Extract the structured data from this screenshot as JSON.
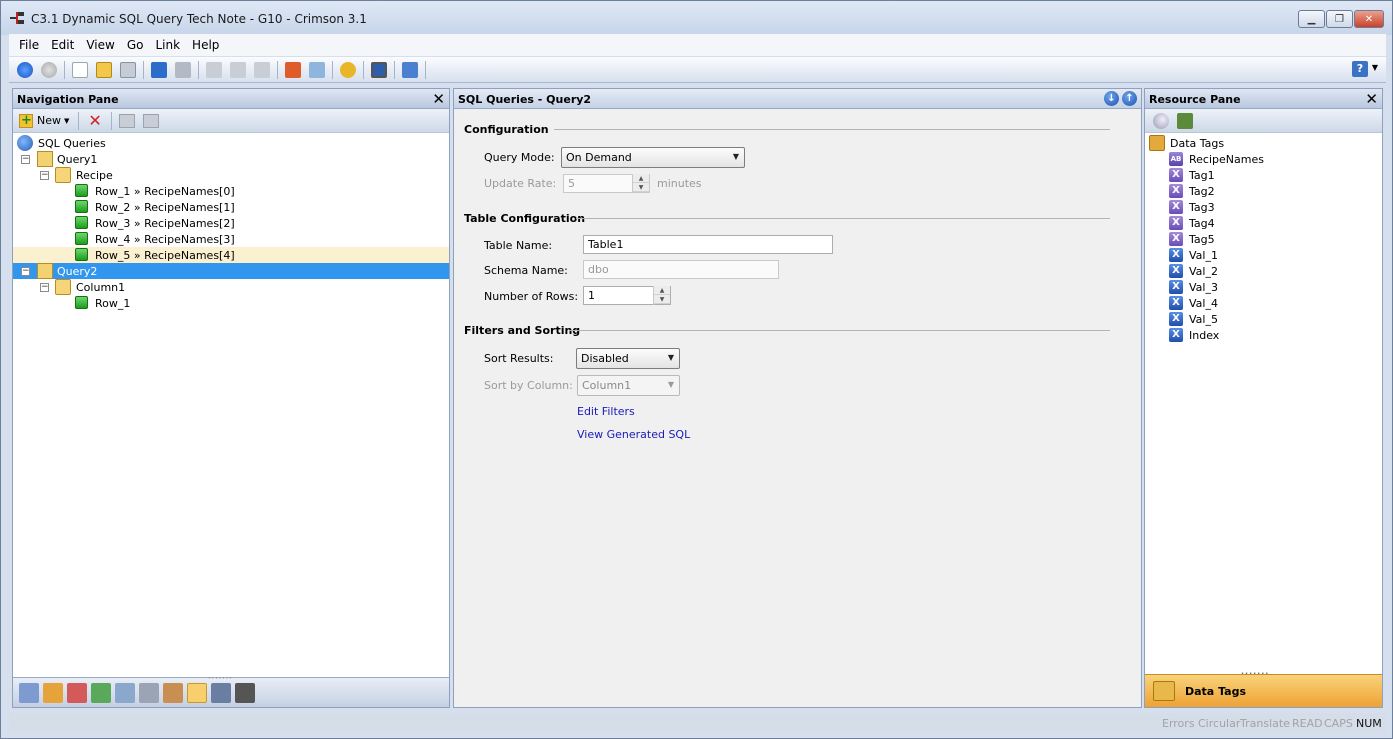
{
  "window": {
    "title": "C3.1 Dynamic SQL Query Tech Note - G10 - Crimson 3.1",
    "minimize": "▁",
    "maximize": "❐",
    "close": "✕"
  },
  "menu": [
    "File",
    "Edit",
    "View",
    "Go",
    "Link",
    "Help"
  ],
  "toolbar": {
    "help_label": "?"
  },
  "nav_pane": {
    "title": "Navigation Pane",
    "new_label": "New",
    "tree": {
      "root": "SQL Queries",
      "query1": "Query1",
      "recipe": "Recipe",
      "rows1": [
        "Row_1 » RecipeNames[0]",
        "Row_2 » RecipeNames[1]",
        "Row_3 » RecipeNames[2]",
        "Row_4 » RecipeNames[3]",
        "Row_5 » RecipeNames[4]"
      ],
      "query2": "Query2",
      "column1": "Column1",
      "rows2": [
        "Row_1"
      ]
    },
    "selected_item": "Query2"
  },
  "editor": {
    "title": "SQL Queries - Query2",
    "configuration": {
      "section": "Configuration",
      "query_mode_label": "Query Mode:",
      "query_mode_value": "On Demand",
      "update_rate_label": "Update Rate:",
      "update_rate_value": "5",
      "update_rate_unit": "minutes"
    },
    "table_configuration": {
      "section": "Table Configuration",
      "table_name_label": "Table Name:",
      "table_name_value": "Table1",
      "schema_name_label": "Schema Name:",
      "schema_name_placeholder": "dbo",
      "rows_label": "Number of Rows:",
      "rows_value": "1"
    },
    "filters": {
      "section": "Filters and Sorting",
      "sort_results_label": "Sort Results:",
      "sort_results_value": "Disabled",
      "sort_by_label": "Sort by Column:",
      "sort_by_value": "Column1",
      "edit_filters": "Edit Filters",
      "view_sql": "View Generated SQL"
    }
  },
  "resource_pane": {
    "title": "Resource Pane",
    "root": "Data Tags",
    "tags": [
      {
        "name": "RecipeNames",
        "kind": "str"
      },
      {
        "name": "Tag1",
        "kind": "purple"
      },
      {
        "name": "Tag2",
        "kind": "purple"
      },
      {
        "name": "Tag3",
        "kind": "purple"
      },
      {
        "name": "Tag4",
        "kind": "purple"
      },
      {
        "name": "Tag5",
        "kind": "purple"
      },
      {
        "name": "Val_1",
        "kind": "blue"
      },
      {
        "name": "Val_2",
        "kind": "blue"
      },
      {
        "name": "Val_3",
        "kind": "blue"
      },
      {
        "name": "Val_4",
        "kind": "blue"
      },
      {
        "name": "Val_5",
        "kind": "blue"
      },
      {
        "name": "Index",
        "kind": "blue"
      }
    ],
    "bottom_label": "Data Tags"
  },
  "statusbar": {
    "errors": "Errors",
    "circular": "Circular",
    "translate": "Translate",
    "read": "READ",
    "caps": "CAPS",
    "num": "NUM"
  },
  "colors": {
    "selection": "#3296ee",
    "soft_selection": "#fbf0d0",
    "link": "#1a1ab8",
    "active_category": "#eea234"
  }
}
